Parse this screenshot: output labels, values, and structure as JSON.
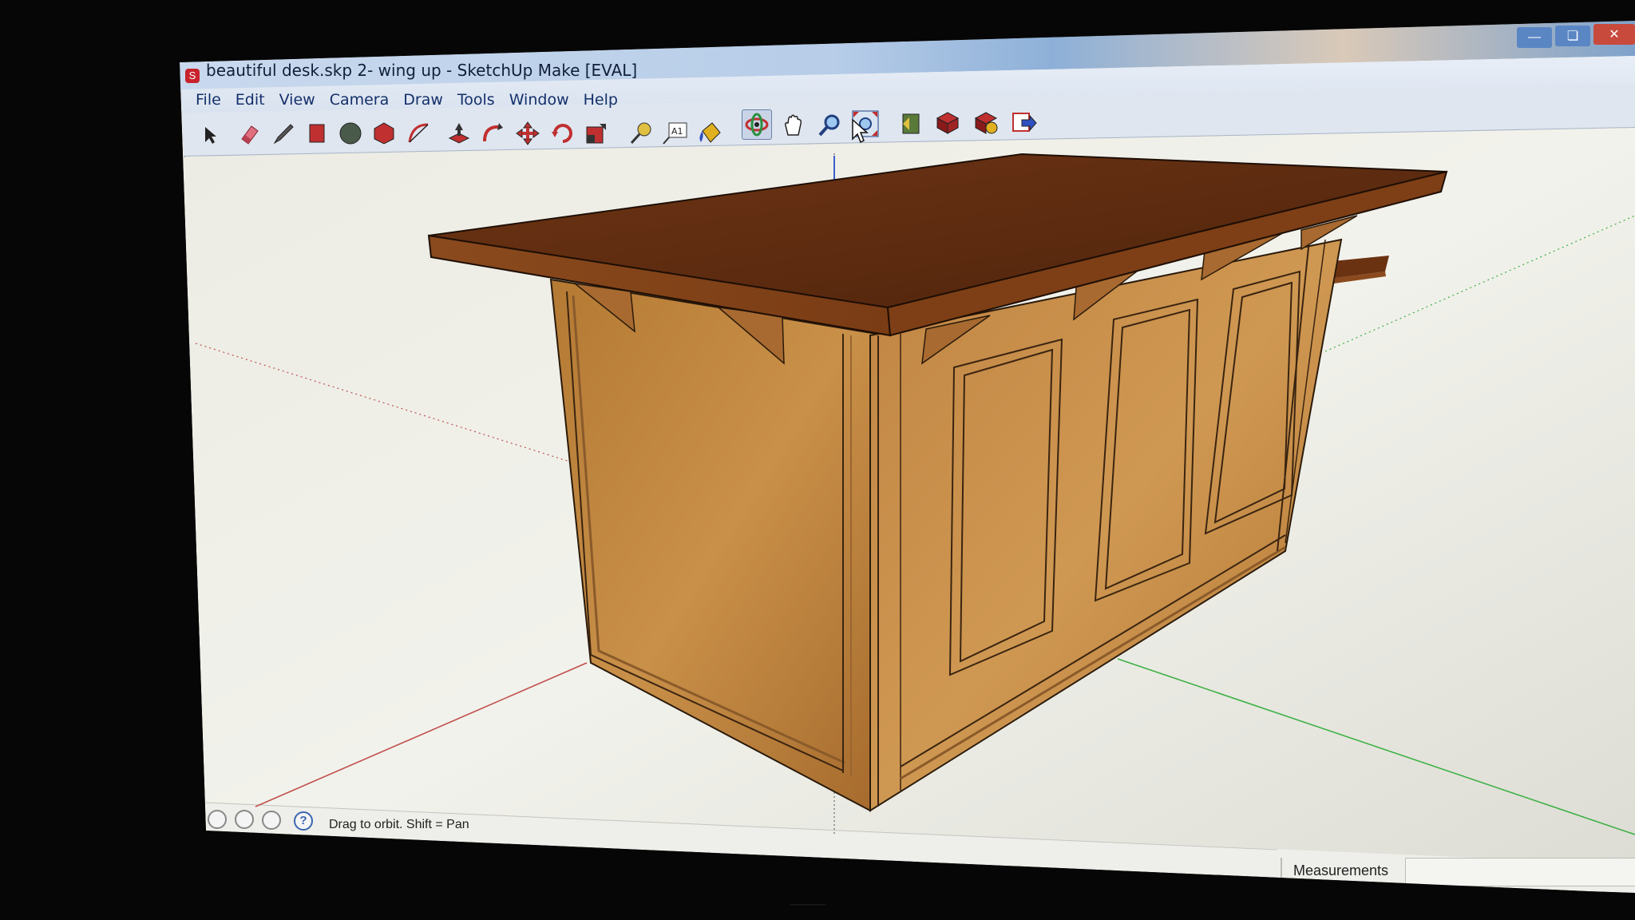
{
  "window": {
    "title": "beautiful desk.skp 2- wing up - SketchUp Make [EVAL]",
    "app_icon_letter": "S"
  },
  "menu": [
    "File",
    "Edit",
    "View",
    "Camera",
    "Draw",
    "Tools",
    "Window",
    "Help"
  ],
  "toolbar": {
    "active_tool": "orbit-icon",
    "tools": [
      "select-icon",
      "eraser-icon",
      "pencil-icon",
      "rectangle-icon",
      "circle-icon",
      "polygon-icon",
      "arc-icon",
      "push-pull-icon",
      "follow-me-icon",
      "move-icon",
      "rotate-icon",
      "scale-icon",
      "tape-measure-icon",
      "text-icon",
      "paint-bucket-icon",
      "orbit-icon",
      "pan-icon",
      "zoom-icon",
      "zoom-extents-icon",
      "previous-view-icon",
      "get-models-icon",
      "share-model-icon",
      "export-icon"
    ],
    "text_tool_label": "A1"
  },
  "status": {
    "hint": "Drag to orbit.  Shift = Pan",
    "help_glyph": "?"
  },
  "measurements": {
    "label": "Measurements",
    "value": ""
  },
  "colors": {
    "axis_red": "#c0504d",
    "axis_green": "#3cb043",
    "axis_blue": "#3a5fcd",
    "wood_light": "#c58a3e",
    "wood_dark": "#7a3e14",
    "top_dark": "#5a2a10"
  }
}
